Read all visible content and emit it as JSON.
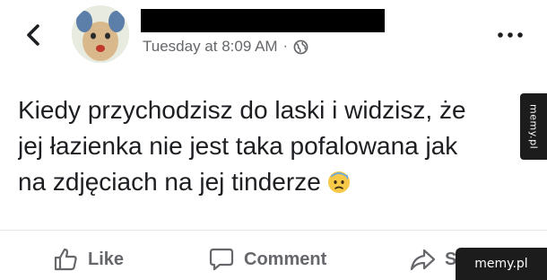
{
  "header": {
    "timestamp": "Tuesday at 8:09 AM",
    "separator": "·",
    "privacy_icon": "globe-icon",
    "back_icon": "chevron-left-icon",
    "more_icon": "more-horizontal-icon"
  },
  "post": {
    "line1": "Kiedy przychodzisz do laski i widzisz, że",
    "line2": "jej łazienka nie jest taka pofalowana jak",
    "line3": "na zdjęciach na jej tinderze",
    "emoji": "anxious-face-with-sweat"
  },
  "actions": {
    "like": "Like",
    "comment": "Comment",
    "share": "Share"
  },
  "watermarks": {
    "side": "memy.pl",
    "bottom": "memy.pl"
  },
  "colors": {
    "text": "#1c1e21",
    "secondary": "#65676b",
    "divider": "#e4e6eb",
    "watermark_bg": "#1c1c1c"
  }
}
